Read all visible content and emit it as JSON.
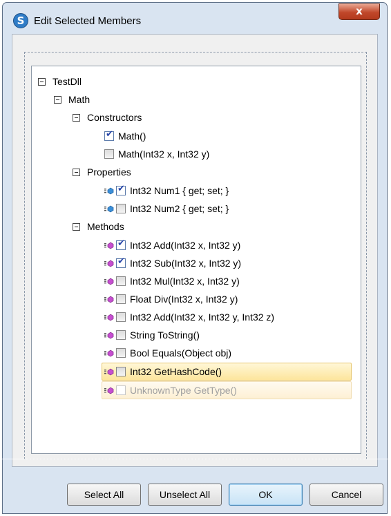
{
  "window": {
    "title": "Edit Selected Members",
    "app_icon_glyph": "S",
    "close_glyph": "x"
  },
  "tree": {
    "root": {
      "label": "TestDll"
    },
    "class": {
      "label": "Math"
    },
    "groups": {
      "constructors": "Constructors",
      "properties": "Properties",
      "methods": "Methods"
    },
    "constructors": [
      {
        "label": "Math()",
        "checked": true
      },
      {
        "label": "Math(Int32 x, Int32 y)",
        "checked": false
      }
    ],
    "properties": [
      {
        "label": "Int32 Num1 { get; set; }",
        "checked": true,
        "icon": "property-icon"
      },
      {
        "label": "Int32 Num2 { get; set; }",
        "checked": false,
        "icon": "property-icon"
      }
    ],
    "methods": [
      {
        "label": "Int32 Add(Int32 x, Int32 y)",
        "checked": true,
        "icon": "method-icon"
      },
      {
        "label": "Int32 Sub(Int32 x, Int32 y)",
        "checked": true,
        "icon": "method-icon"
      },
      {
        "label": "Int32 Mul(Int32 x, Int32 y)",
        "checked": false,
        "icon": "method-icon"
      },
      {
        "label": "Float Div(Int32 x, Int32 y)",
        "checked": false,
        "icon": "method-icon"
      },
      {
        "label": "Int32 Add(Int32 x, Int32 y, Int32 z)",
        "checked": false,
        "icon": "method-icon"
      },
      {
        "label": "String ToString()",
        "checked": false,
        "icon": "method-icon"
      },
      {
        "label": "Bool Equals(Object obj)",
        "checked": false,
        "icon": "method-icon"
      },
      {
        "label": "Int32 GetHashCode()",
        "checked": false,
        "icon": "method-icon",
        "state": "selected"
      },
      {
        "label": "UnknownType GetType()",
        "checked": false,
        "icon": "method-icon",
        "state": "hover-disabled"
      }
    ]
  },
  "buttons": {
    "select_all": "Select All",
    "unselect_all": "Unselect All",
    "ok": "OK",
    "cancel": "Cancel"
  },
  "colors": {
    "accent": "#2f7cc7",
    "property_icon": "#3a8fd8",
    "method_icon": "#c64fd0",
    "selection": "#fde59c"
  }
}
